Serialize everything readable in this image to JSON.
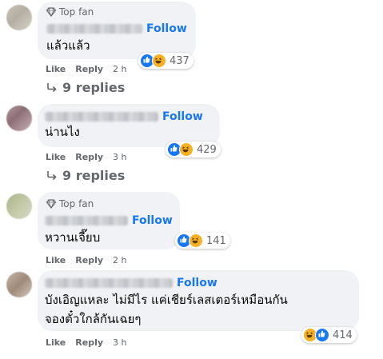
{
  "comments": [
    {
      "top_fan": "Top fan",
      "follow": "Follow",
      "text": "แล้วแล้ว",
      "like": "Like",
      "reply": "Reply",
      "time": "2 h",
      "reactions": [
        "like-icon",
        "haha-icon"
      ],
      "reaction_count": "437",
      "replies_label": "9 replies"
    },
    {
      "follow": "Follow",
      "text": "น่านไง",
      "like": "Like",
      "reply": "Reply",
      "time": "3 h",
      "reactions": [
        "like-icon",
        "haha-icon"
      ],
      "reaction_count": "429",
      "replies_label": "9 replies"
    },
    {
      "top_fan": "Top fan",
      "follow": "Follow",
      "text": "หวานเจี๊ยบ",
      "like": "Like",
      "reply": "Reply",
      "time": "2 h",
      "reactions": [
        "like-icon",
        "haha-icon"
      ],
      "reaction_count": "141"
    },
    {
      "follow": "Follow",
      "text_lines": [
        "บังเอิญแหละ ไม่มีไร แค่เชียร์เลสเตอร์เหมือนกัน",
        "จองตั๋วใกล้กันเฉยๆ"
      ],
      "like": "Like",
      "reply": "Reply",
      "time": "3 h",
      "reactions": [
        "haha-icon",
        "like-icon"
      ],
      "reaction_count": "414"
    }
  ],
  "colors": {
    "bubble": "#f0f2f5",
    "follow": "#1877f2",
    "muted": "#65676b",
    "like": "#1877f2",
    "haha": "#f7b125"
  }
}
